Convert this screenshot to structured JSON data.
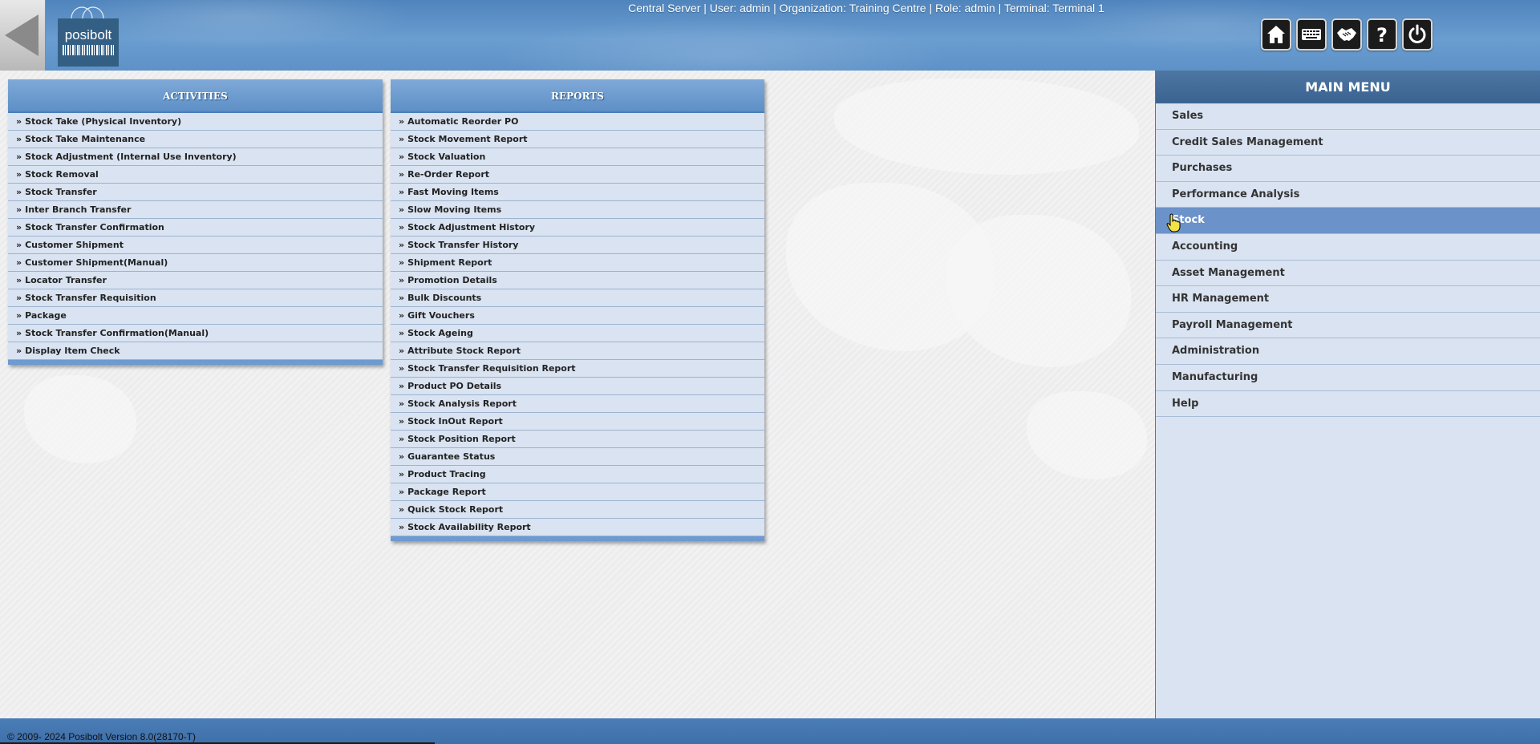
{
  "header": {
    "session_info": "Central Server | User: admin | Organization: Training Centre | Role: admin | Terminal: Terminal 1",
    "logo_text": "posibolt",
    "toolbar": [
      {
        "icon": "home-icon"
      },
      {
        "icon": "keyboard-icon"
      },
      {
        "icon": "handshake-icon"
      },
      {
        "icon": "help-icon"
      },
      {
        "icon": "power-icon"
      }
    ]
  },
  "activities": {
    "title": "ACTIVITIES",
    "items": [
      "Stock Take (Physical Inventory)",
      "Stock Take Maintenance",
      "Stock Adjustment (Internal Use Inventory)",
      "Stock Removal",
      "Stock Transfer",
      "Inter Branch Transfer",
      "Stock Transfer Confirmation",
      "Customer Shipment",
      "Customer Shipment(Manual)",
      "Locator Transfer",
      "Stock Transfer Requisition",
      "Package",
      "Stock Transfer Confirmation(Manual)",
      "Display Item Check"
    ]
  },
  "reports": {
    "title": "REPORTS",
    "items": [
      "Automatic Reorder PO",
      "Stock Movement Report",
      "Stock Valuation",
      "Re-Order Report",
      "Fast Moving Items",
      "Slow Moving Items",
      "Stock Adjustment History",
      "Stock Transfer History",
      "Shipment Report",
      "Promotion Details",
      "Bulk Discounts",
      "Gift Vouchers",
      "Stock Ageing",
      "Attribute Stock Report",
      "Stock Transfer Requisition Report",
      "Product PO Details",
      "Stock Analysis Report",
      "Stock InOut Report",
      "Stock Position Report",
      "Guarantee Status",
      "Product Tracing",
      "Package Report",
      "Quick Stock Report",
      "Stock Availability Report"
    ]
  },
  "main_menu": {
    "title": "MAIN MENU",
    "active": "Stock",
    "items": [
      "Sales",
      "Credit Sales Management",
      "Purchases",
      "Performance Analysis",
      "Stock",
      "Accounting",
      "Asset Management",
      "HR Management",
      "Payroll Management",
      "Administration",
      "Manufacturing",
      "Help"
    ]
  },
  "footer": {
    "text": "© 2009- 2024 Posibolt Version  8.0(28170-T)"
  },
  "colors": {
    "header_blue": "#5e92c8",
    "panel_bg": "#d9e3f1",
    "active_menu": "#6b92c9"
  }
}
